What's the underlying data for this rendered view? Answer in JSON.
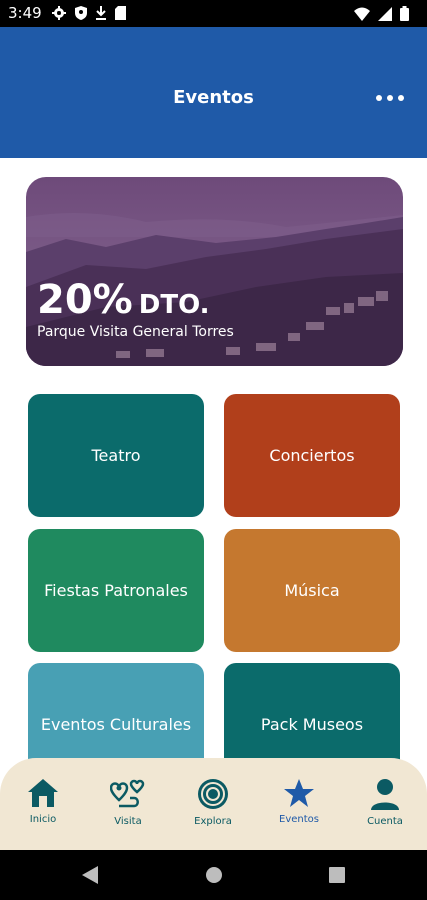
{
  "status": {
    "time": "3:49",
    "left_icons": [
      "settings-icon",
      "shield-icon",
      "download-icon",
      "sd-card-icon"
    ],
    "right_icons": [
      "wifi-icon",
      "signal-icon",
      "battery-icon"
    ]
  },
  "header": {
    "title": "Eventos",
    "menu_icon": "more-horizontal-icon"
  },
  "promo": {
    "percent": "20%",
    "suffix": "DTO.",
    "subtitle": "Parque Visita General Torres"
  },
  "categories": [
    {
      "label": "Teatro",
      "color": "#0b6b6b"
    },
    {
      "label": "Conciertos",
      "color": "#b13f1b"
    },
    {
      "label": "Fiestas Patronales",
      "color": "#1f8a5f"
    },
    {
      "label": "Música",
      "color": "#c5782f"
    },
    {
      "label": "Eventos Culturales",
      "color": "#48a0b4"
    },
    {
      "label": "Pack Museos",
      "color": "#0b6b6b"
    }
  ],
  "bottom_nav": {
    "items": [
      {
        "label": "Inicio",
        "icon": "home-icon"
      },
      {
        "label": "Visita",
        "icon": "route-icon"
      },
      {
        "label": "Explora",
        "icon": "target-icon"
      },
      {
        "label": "Eventos",
        "icon": "star-icon",
        "active": true
      },
      {
        "label": "Cuenta",
        "icon": "user-icon"
      }
    ]
  },
  "system_nav": [
    "back-icon",
    "home-circle-icon",
    "recents-icon"
  ],
  "colors": {
    "header": "#1f5aa8",
    "nav_bg": "#f1e7d3",
    "nav_icon": "#0b5a63",
    "nav_active": "#1f5aa8"
  }
}
